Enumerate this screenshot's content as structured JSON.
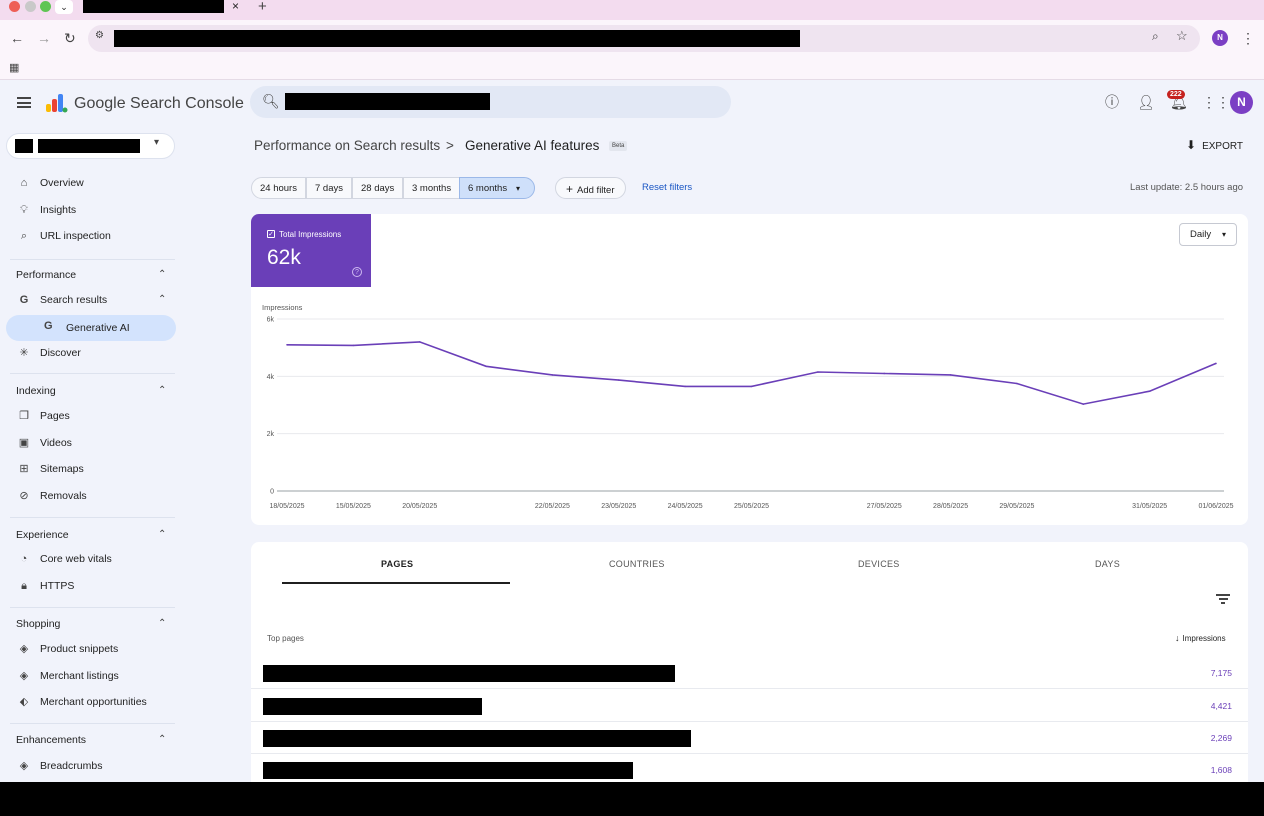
{
  "browser": {
    "tab_close": "×",
    "tab_new": "+",
    "profile_initial": "N"
  },
  "app": {
    "name": "Google Search Console",
    "notification_count": "222",
    "avatar_initial": "N"
  },
  "sidebar": {
    "top_items": [
      {
        "label": "Overview",
        "icon": "home-icon"
      },
      {
        "label": "Insights",
        "icon": "lightbulb-icon"
      },
      {
        "label": "URL inspection",
        "icon": "search-icon"
      }
    ],
    "performance": {
      "header": "Performance",
      "items": [
        {
          "label": "Search results",
          "icon": "google-g-icon"
        },
        {
          "label": "Generative AI",
          "icon": "google-g-icon",
          "active": true
        },
        {
          "label": "Discover",
          "icon": "asterisk-icon"
        }
      ]
    },
    "indexing": {
      "header": "Indexing",
      "items": [
        {
          "label": "Pages",
          "icon": "pages-icon"
        },
        {
          "label": "Videos",
          "icon": "video-icon"
        },
        {
          "label": "Sitemaps",
          "icon": "sitemap-icon"
        },
        {
          "label": "Removals",
          "icon": "eye-off-icon"
        }
      ]
    },
    "experience": {
      "header": "Experience",
      "items": [
        {
          "label": "Core web vitals",
          "icon": "gauge-icon"
        },
        {
          "label": "HTTPS",
          "icon": "lock-icon"
        }
      ]
    },
    "shopping": {
      "header": "Shopping",
      "items": [
        {
          "label": "Product snippets",
          "icon": "layers-icon"
        },
        {
          "label": "Merchant listings",
          "icon": "layers-icon"
        },
        {
          "label": "Merchant opportunities",
          "icon": "tag-icon"
        }
      ]
    },
    "enhancements": {
      "header": "Enhancements",
      "items": [
        {
          "label": "Breadcrumbs",
          "icon": "layers-icon"
        }
      ]
    }
  },
  "breadcrumb": {
    "parent": "Performance on Search results",
    "separator": ">",
    "current": "Generative AI features",
    "badge": "Beta"
  },
  "export_label": "EXPORT",
  "date_filters": [
    "24 hours",
    "7 days",
    "28 days",
    "3 months",
    "6 months"
  ],
  "date_selected": "6 months",
  "add_filter_label": "Add filter",
  "reset_filters_label": "Reset filters",
  "last_update": "Last update: 2.5 hours ago",
  "metric": {
    "label": "Total Impressions",
    "value": "62k",
    "help": "?"
  },
  "granularity": "Daily",
  "chart_data": {
    "type": "line",
    "ylabel": "Impressions",
    "y_ticks": [
      "0",
      "2k",
      "4k",
      "6k"
    ],
    "ylim": [
      0,
      6000
    ],
    "x": [
      "18/05/2025",
      "15/05/2025",
      "20/05/2025",
      "22/05/2025",
      "23/05/2025",
      "24/05/2025",
      "25/05/2025",
      "27/05/2025",
      "28/05/2025",
      "29/05/2025",
      "31/05/2025",
      "01/06/2025"
    ],
    "x_tick_labels": [
      "18/05/2025",
      "15/05/2025",
      "20/05/2025",
      "",
      "22/05/2025",
      "23/05/2025",
      "24/05/2025",
      "25/05/2025",
      "",
      "27/05/2025",
      "28/05/2025",
      "29/05/2025",
      "",
      "31/05/2025",
      "01/06/2025"
    ],
    "series": [
      {
        "color": "#6a3fb8",
        "values": [
          5100,
          5080,
          5200,
          4350,
          4050,
          3870,
          3650,
          3650,
          4150,
          4100,
          4050,
          3750,
          3030,
          3480,
          4450
        ]
      }
    ],
    "grid": true,
    "legend": "none"
  },
  "table": {
    "tabs": [
      "PAGES",
      "COUNTRIES",
      "DEVICES",
      "DAYS"
    ],
    "active_tab": "PAGES",
    "col_left": "Top pages",
    "col_right": "Impressions",
    "sort_arrow": "↓",
    "rows": [
      {
        "value": "7,175"
      },
      {
        "value": "4,421"
      },
      {
        "value": "2,269"
      },
      {
        "value": "1,608"
      }
    ]
  }
}
